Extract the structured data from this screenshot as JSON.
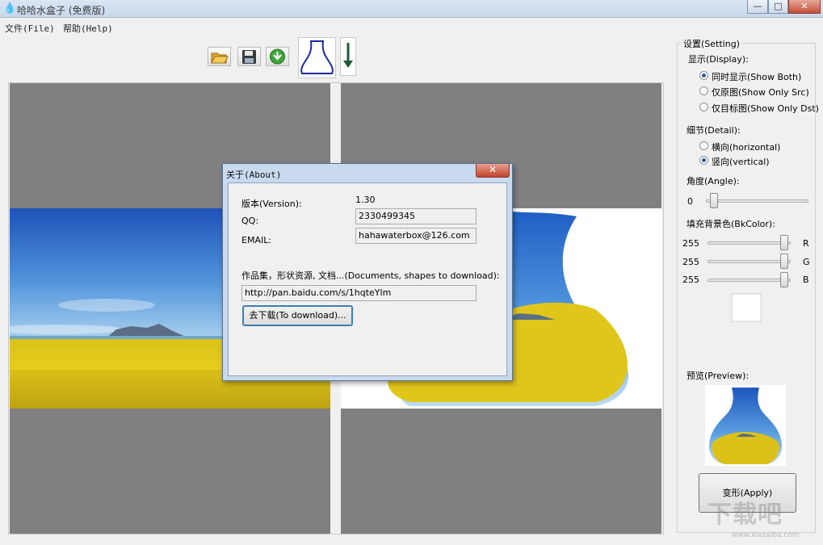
{
  "window": {
    "title": "哈哈水盒子 (免费版)",
    "controls": {
      "minimize": "—",
      "maximize": "□",
      "close": "✕"
    }
  },
  "menu": [
    {
      "label": "文件(File)"
    },
    {
      "label": "帮助(Help)"
    }
  ],
  "toolbar": {
    "open_icon": "folder-open-icon",
    "save_icon": "floppy-save-icon",
    "download_icon": "green-download-icon",
    "shape_icon": "flask-shape-icon",
    "arrow_icon": "down-arrow-icon"
  },
  "about_dialog": {
    "title": "关于(About)",
    "close": "✕",
    "version_label": "版本(Version):",
    "version_value": "1.30",
    "qq_label": "QQ:",
    "qq_value": "2330499345",
    "email_label": "EMAIL:",
    "email_value": "hahawaterbox@126.com",
    "collection_label": "作品集，形状资源, 文档...(Documents, shapes to download):",
    "url_value": "http://pan.baidu.com/s/1hqteYlm",
    "download_button": "去下载(To download)..."
  },
  "settings": {
    "legend": "设置(Setting)",
    "display": {
      "label": "显示(Display):",
      "options": [
        "同时显示(Show Both)",
        "仅原图(Show Only Src)",
        "仅目标图(Show Only Dst)"
      ],
      "selected": 0
    },
    "detail": {
      "label": "细节(Detail):",
      "options": [
        "横向(horizontal)",
        "竖向(vertical)"
      ],
      "selected": 1
    },
    "angle": {
      "label": "角度(Angle):",
      "value": "0"
    },
    "bkcolor": {
      "label": "填充背景色(BkColor):",
      "r": "255",
      "g": "255",
      "b": "255",
      "r_label": "R",
      "g_label": "G",
      "b_label": "B",
      "color": "#ffffff"
    },
    "preview_label": "预览(Preview):",
    "apply_button": "变形(Apply)"
  },
  "watermark": {
    "logo": "下载吧",
    "url": "www.xiazaiba.com"
  }
}
